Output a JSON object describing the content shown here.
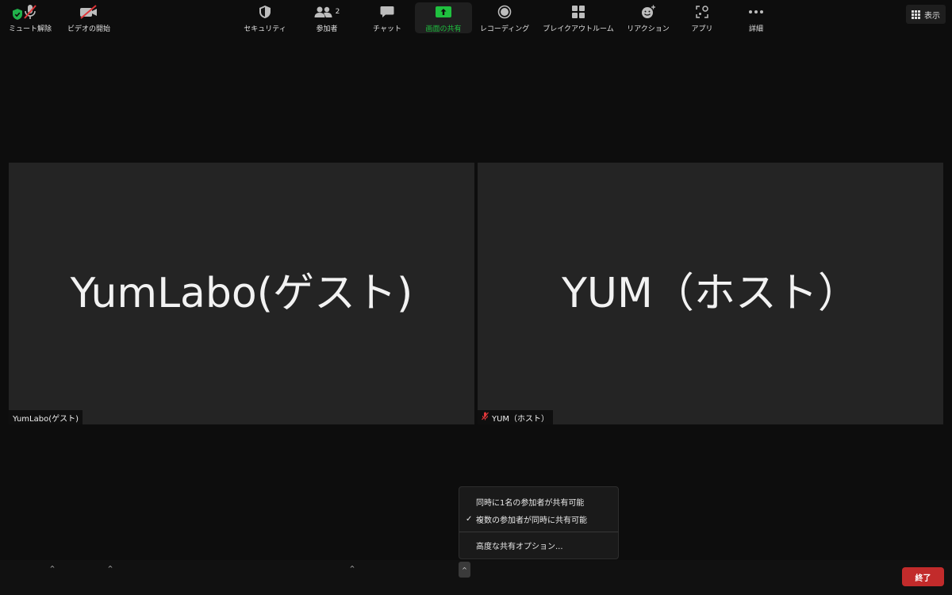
{
  "header": {
    "view_label": "表示"
  },
  "tiles": [
    {
      "display_name": "YumLabo(ゲスト)",
      "tag_name": "YumLabo(ゲスト)",
      "muted": false
    },
    {
      "display_name": "YUM（ホスト）",
      "tag_name": "YUM（ホスト）",
      "muted": true
    }
  ],
  "share_menu": {
    "items": [
      {
        "label": "同時に1名の参加者が共有可能",
        "checked": false
      },
      {
        "label": "複数の参加者が同時に共有可能",
        "checked": true
      },
      {
        "label": "高度な共有オプション..."
      }
    ],
    "check_glyph": "✓"
  },
  "toolbar": {
    "mute_label": "ミュート解除",
    "video_label": "ビデオの開始",
    "security_label": "セキュリティ",
    "participants_label": "参加者",
    "participants_count": "2",
    "chat_label": "チャット",
    "share_label": "画面の共有",
    "record_label": "レコーディング",
    "breakout_label": "ブレイクアウトルーム",
    "reactions_label": "リアクション",
    "apps_label": "アプリ",
    "more_label": "詳細",
    "end_label": "終了",
    "caret_glyph": "^"
  },
  "colors": {
    "share_green": "#1fc13f",
    "end_red": "#c22b2b",
    "muted_red": "#e0373a",
    "shield_green": "#21b24b"
  }
}
